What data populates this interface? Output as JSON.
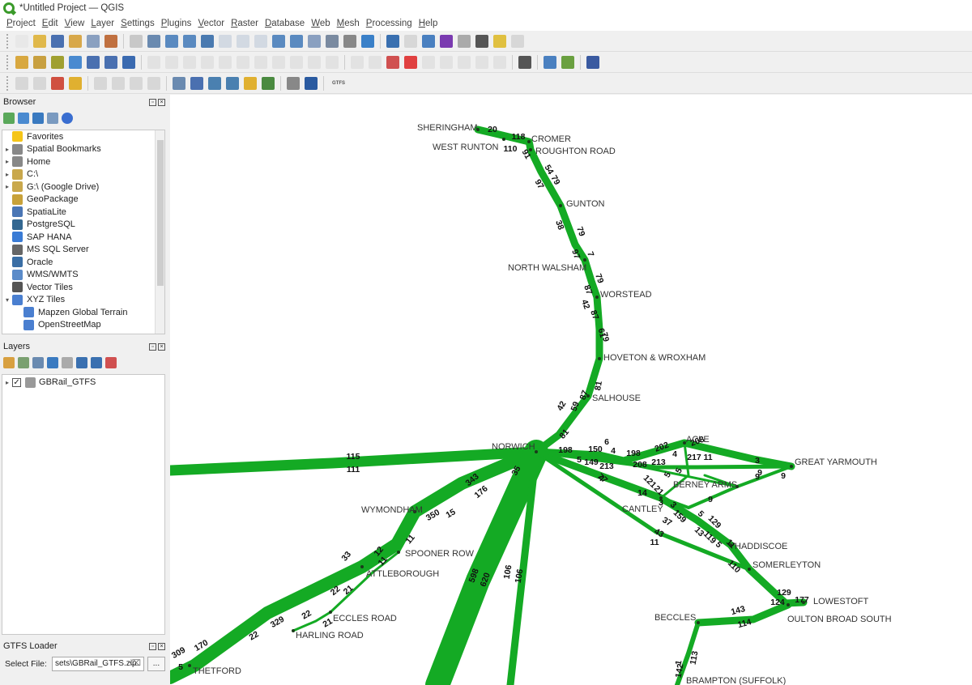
{
  "window": {
    "title": "*Untitled Project — QGIS"
  },
  "menu": [
    "Project",
    "Edit",
    "View",
    "Layer",
    "Settings",
    "Plugins",
    "Vector",
    "Raster",
    "Database",
    "Web",
    "Mesh",
    "Processing",
    "Help"
  ],
  "toolbar": {
    "gtfs_label": "GTFS"
  },
  "browser": {
    "title": "Browser",
    "items": [
      {
        "label": "Favorites",
        "icon": "star-icon",
        "expand": false,
        "color": "#f5c518"
      },
      {
        "label": "Spatial Bookmarks",
        "icon": "bookmark-icon",
        "expand": true,
        "color": "#888"
      },
      {
        "label": "Home",
        "icon": "home-icon",
        "expand": true,
        "color": "#888"
      },
      {
        "label": "C:\\",
        "icon": "folder-icon",
        "expand": true,
        "color": "#c9a84c"
      },
      {
        "label": "G:\\ (Google Drive)",
        "icon": "folder-icon",
        "expand": true,
        "color": "#c9a84c"
      },
      {
        "label": "GeoPackage",
        "icon": "geopackage-icon",
        "expand": false,
        "color": "#c8a23a"
      },
      {
        "label": "SpatiaLite",
        "icon": "spatialite-icon",
        "expand": false,
        "color": "#4a76b5"
      },
      {
        "label": "PostgreSQL",
        "icon": "postgresql-icon",
        "expand": false,
        "color": "#336791"
      },
      {
        "label": "SAP HANA",
        "icon": "sap-hana-icon",
        "expand": false,
        "color": "#3a7bd5"
      },
      {
        "label": "MS SQL Server",
        "icon": "mssql-icon",
        "expand": false,
        "color": "#666"
      },
      {
        "label": "Oracle",
        "icon": "oracle-icon",
        "expand": false,
        "color": "#3a6ea5"
      },
      {
        "label": "WMS/WMTS",
        "icon": "globe-icon",
        "expand": false,
        "color": "#5b8bc9"
      },
      {
        "label": "Vector Tiles",
        "icon": "grid-icon",
        "expand": false,
        "color": "#555"
      },
      {
        "label": "XYZ Tiles",
        "icon": "grid-icon",
        "expand": "open",
        "color": "#4a7fd0"
      },
      {
        "label": "Mapzen Global Terrain",
        "icon": "grid-icon",
        "expand": "child",
        "color": "#4a7fd0"
      },
      {
        "label": "OpenStreetMap",
        "icon": "grid-icon",
        "expand": "child",
        "color": "#4a7fd0"
      }
    ]
  },
  "layers": {
    "title": "Layers",
    "items": [
      {
        "label": "GBRail_GTFS",
        "checked": true
      }
    ]
  },
  "gtfs_loader": {
    "title": "GTFS Loader",
    "select_label": "Select File:",
    "file_value": "sets\\GBRail_GTFS.zip",
    "browse_label": "..."
  },
  "map": {
    "line_color": "#14aa24",
    "stations": [
      {
        "name": "SHERINGHAM"
      },
      {
        "name": "CROMER"
      },
      {
        "name": "WEST RUNTON"
      },
      {
        "name": "ROUGHTON ROAD"
      },
      {
        "name": "GUNTON"
      },
      {
        "name": "NORTH WALSHAM"
      },
      {
        "name": "WORSTEAD"
      },
      {
        "name": "HOVETON & WROXHAM"
      },
      {
        "name": "SALHOUSE"
      },
      {
        "name": "NORWICH"
      },
      {
        "name": "ACLE"
      },
      {
        "name": "GREAT YARMOUTH"
      },
      {
        "name": "BERNEY ARMS"
      },
      {
        "name": "CANTLEY"
      },
      {
        "name": "WYMONDHAM"
      },
      {
        "name": "SPOONER ROW"
      },
      {
        "name": "ATTLEBOROUGH"
      },
      {
        "name": "ECCLES ROAD"
      },
      {
        "name": "HARLING ROAD"
      },
      {
        "name": "THETFORD"
      },
      {
        "name": "HADDISCOE"
      },
      {
        "name": "SOMERLEYTON"
      },
      {
        "name": "LOWESTOFT"
      },
      {
        "name": "OULTON BROAD SOUTH"
      },
      {
        "name": "BECCLES"
      },
      {
        "name": "BRAMPTON (SUFFOLK)"
      }
    ],
    "counts": [
      "20",
      "118",
      "110",
      "91",
      "54",
      "79",
      "97",
      "79",
      "38",
      "7",
      "97",
      "79",
      "87",
      "42",
      "87",
      "79",
      "61",
      "42",
      "59",
      "87",
      "81",
      "81",
      "198",
      "150",
      "6",
      "4",
      "198",
      "202",
      "208",
      "5",
      "149",
      "213",
      "208",
      "213",
      "4",
      "217",
      "11",
      "3",
      "9",
      "9",
      "9",
      "115",
      "111",
      "35",
      "343",
      "176",
      "350",
      "15",
      "11",
      "12",
      "11",
      "33",
      "22",
      "21",
      "329",
      "22",
      "21",
      "22",
      "309",
      "170",
      "5",
      "7",
      "7",
      "4",
      "5",
      "5",
      "9",
      "121",
      "21",
      "14",
      "3",
      "3",
      "5",
      "11",
      "159",
      "129",
      "13",
      "119",
      "5",
      "11",
      "110",
      "37",
      "43",
      "598",
      "620",
      "106",
      "106",
      "129",
      "124",
      "177",
      "143",
      "114",
      "1",
      "142",
      "113"
    ]
  }
}
